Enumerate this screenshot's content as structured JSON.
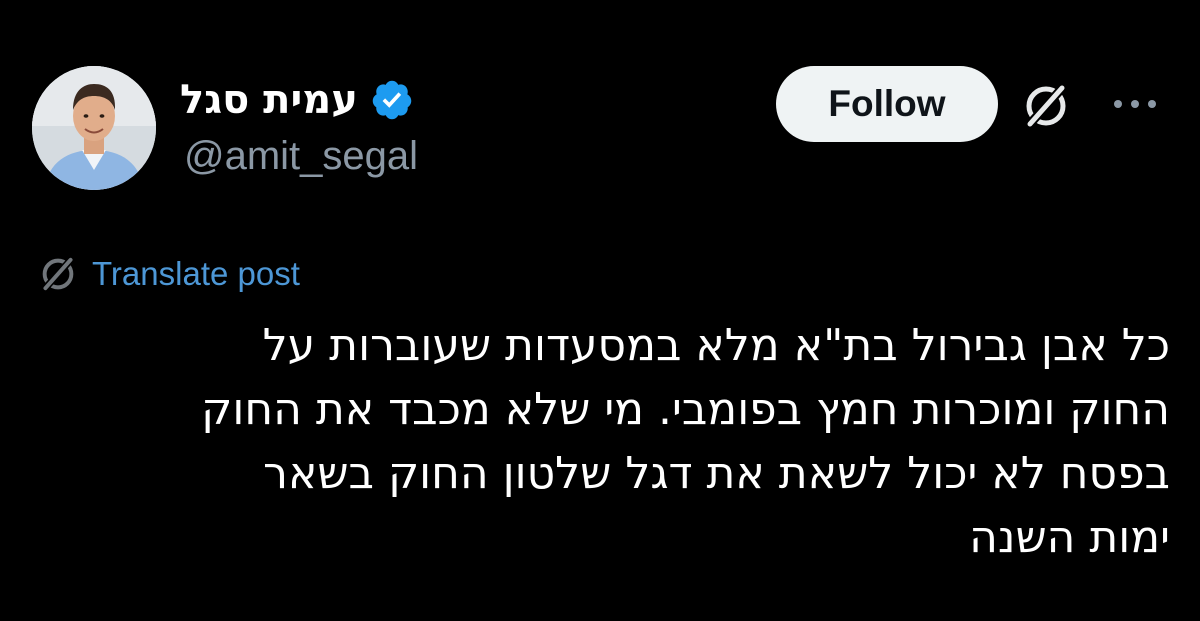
{
  "author": {
    "display_name": "עמית סגל",
    "handle": "@amit_segal",
    "verified": true
  },
  "actions": {
    "follow_label": "Follow",
    "grok_icon": "grok-icon",
    "more_icon": "more-icon"
  },
  "translate": {
    "label": "Translate post",
    "icon": "grok-icon"
  },
  "post": {
    "lines": [
      "כל אבן גבירול בת\"א מלא במסעדות שעוברות על",
      "החוק ומוכרות חמץ בפומבי. מי שלא מכבד את החוק",
      "בפסח לא יכול לשאת את דגל שלטון החוק בשאר",
      "ימות השנה"
    ]
  },
  "colors": {
    "background": "#000000",
    "text": "#ffffff",
    "secondary_text": "#8b98a5",
    "link": "#4d97d6",
    "verified": "#1d9bf0",
    "follow_bg": "#eff3f4"
  }
}
